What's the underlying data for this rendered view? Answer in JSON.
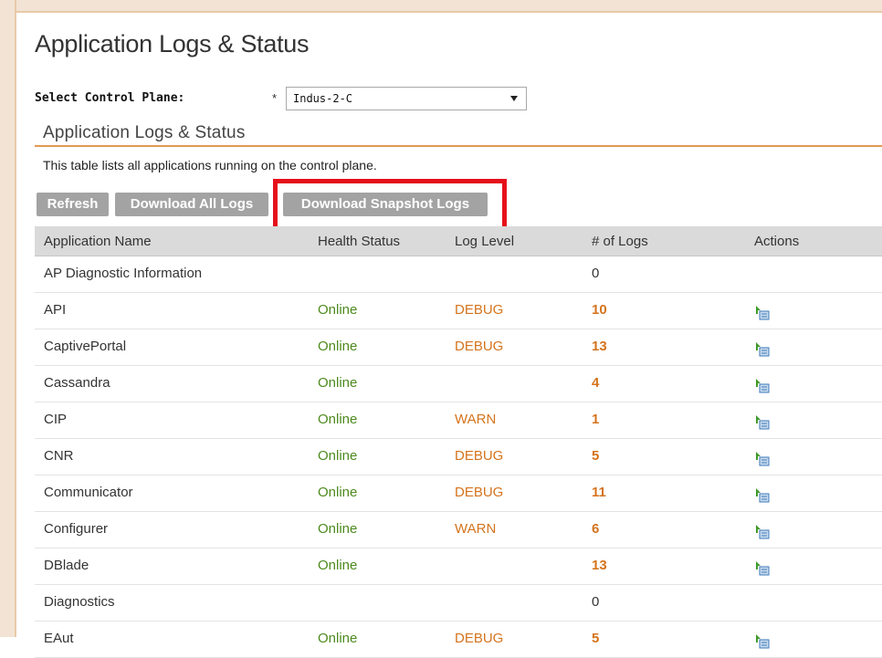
{
  "page": {
    "title": "Application Logs & Status",
    "control_plane_label": "Select Control Plane:",
    "required_marker": "*",
    "control_plane_value": "Indus-2-C",
    "section_title": "Application Logs & Status",
    "description": "This table lists all applications running on the control plane."
  },
  "toolbar": {
    "refresh_label": "Refresh",
    "download_all_label": "Download All Logs",
    "download_snapshot_label": "Download Snapshot Logs"
  },
  "table": {
    "headers": {
      "name": "Application Name",
      "health": "Health Status",
      "level": "Log Level",
      "logs": "# of Logs",
      "actions": "Actions"
    },
    "rows": [
      {
        "name": "AP Diagnostic Information",
        "health": "",
        "level": "",
        "logs": "0",
        "action": false
      },
      {
        "name": "API",
        "health": "Online",
        "level": "DEBUG",
        "logs": "10",
        "action": true
      },
      {
        "name": "CaptivePortal",
        "health": "Online",
        "level": "DEBUG",
        "logs": "13",
        "action": true
      },
      {
        "name": "Cassandra",
        "health": "Online",
        "level": "",
        "logs": "4",
        "action": true
      },
      {
        "name": "CIP",
        "health": "Online",
        "level": "WARN",
        "logs": "1",
        "action": true
      },
      {
        "name": "CNR",
        "health": "Online",
        "level": "DEBUG",
        "logs": "5",
        "action": true
      },
      {
        "name": "Communicator",
        "health": "Online",
        "level": "DEBUG",
        "logs": "11",
        "action": true
      },
      {
        "name": "Configurer",
        "health": "Online",
        "level": "WARN",
        "logs": "6",
        "action": true
      },
      {
        "name": "DBlade",
        "health": "Online",
        "level": "",
        "logs": "13",
        "action": true
      },
      {
        "name": "Diagnostics",
        "health": "",
        "level": "",
        "logs": "0",
        "action": false
      },
      {
        "name": "EAut",
        "health": "Online",
        "level": "DEBUG",
        "logs": "5",
        "action": true
      }
    ]
  },
  "icons": {
    "action_icon": "download-log-icon"
  }
}
